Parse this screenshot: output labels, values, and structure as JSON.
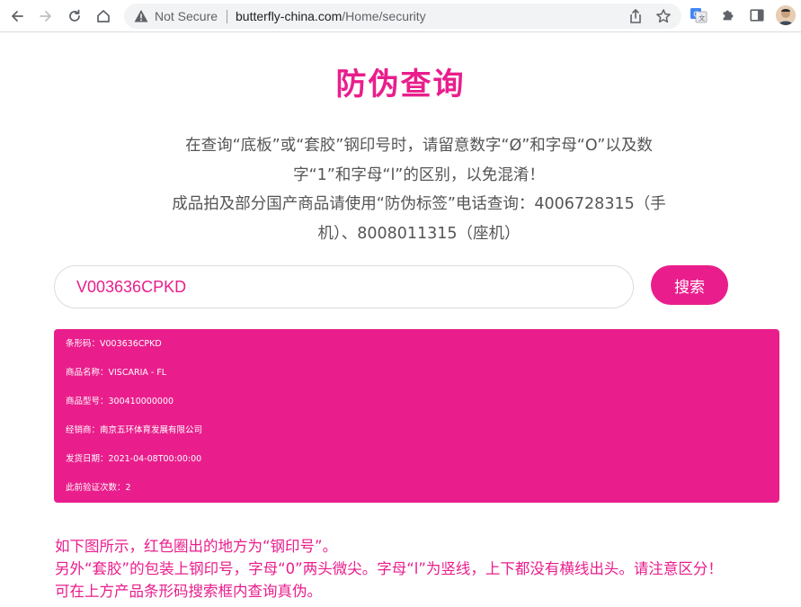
{
  "browser": {
    "security_label": "Not Secure",
    "url_host": "butterfly-china.com",
    "url_path": "/Home/security"
  },
  "page": {
    "title": "防伪查询",
    "notice_lines": [
      "在查询“底板”或“套胶”钢印号时，请留意数字“Ø”和字母“O”以及数",
      "字“1”和字母“l”的区别，以免混淆！",
      "成品拍及部分国产商品请使用“防伪标签”电话查询：4006728315（手",
      "机）、8008011315（座机）"
    ],
    "search": {
      "value": "V003636CPKD",
      "button_label": "搜索"
    },
    "result": [
      "条形码：V003636CPKD",
      "商品名称：VISCARIA - FL",
      "商品型号：300410000000",
      "经销商：南京五环体育发展有限公司",
      "发货日期：2021-04-08T00:00:00",
      "此前验证次数：2"
    ],
    "footer_lines": [
      "如下图所示，红色圈出的地方为“钢印号”。",
      "另外“套胶”的包装上钢印号，字母“0”两头微尖。字母“l”为竖线，上下都没有横线出头。请注意区分！",
      "可在上方产品条形码搜索框内查询真伪。"
    ]
  },
  "colors": {
    "accent": "#e91e8c",
    "text": "#555555"
  }
}
